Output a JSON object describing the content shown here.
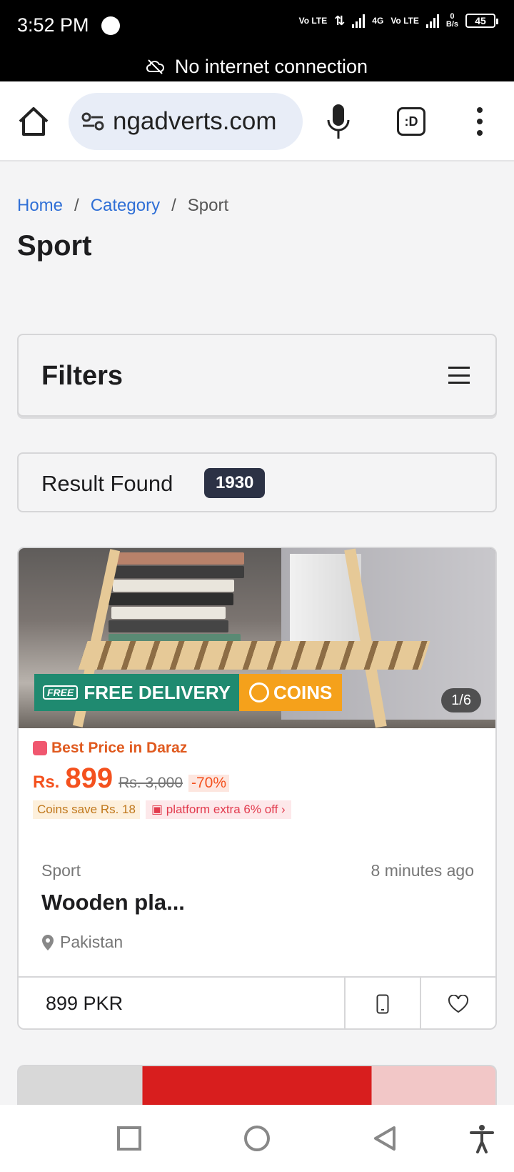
{
  "status_bar": {
    "time": "3:52 PM",
    "battery": "45",
    "net_speed_value": "0",
    "net_speed_unit": "B/s",
    "lte1": "Vo LTE",
    "lte2": "Vo LTE",
    "network_type": "4G"
  },
  "offline_banner": {
    "text": "No internet connection"
  },
  "browser": {
    "url": "ngadverts.com",
    "tab_icon_label": ":D"
  },
  "breadcrumb": {
    "home": "Home",
    "category": "Category",
    "current": "Sport",
    "separator": "/"
  },
  "page": {
    "title": "Sport"
  },
  "filters": {
    "title": "Filters"
  },
  "results": {
    "label": "Result Found",
    "count": "1930"
  },
  "listing": {
    "image_counter": "1/6",
    "banner_free": "FREE DELIVERY",
    "banner_free_badge": "FREE",
    "banner_coins": "COINS",
    "promo_tag": "Best Price in Daraz",
    "price_currency": "Rs.",
    "price_value": "899",
    "price_old": "Rs. 3,000",
    "price_discount": "-70%",
    "coins_save": "Coins save Rs. 18",
    "platform_extra": "platform extra 6% off",
    "category": "Sport",
    "posted": "8 minutes ago",
    "title": "Wooden pla...",
    "location": "Pakistan",
    "price_footer": "899 PKR"
  },
  "icons": {
    "home": "home-icon",
    "site_settings": "site-settings-icon",
    "mic": "mic-icon",
    "tabs": "tab-switcher-icon",
    "menu": "more-vert-icon",
    "filters": "hamburger-icon",
    "location": "location-pin-icon",
    "phone": "phone-icon",
    "favorite": "heart-icon",
    "nav_recent": "square-icon",
    "nav_home": "circle-icon",
    "nav_back": "triangle-back-icon",
    "accessibility": "accessibility-icon"
  },
  "colors": {
    "link": "#2f6fd6",
    "badge_bg": "#2c3245",
    "price_accent": "#f4511e",
    "free_delivery": "#1f8a70",
    "coins": "#f5a11b"
  }
}
